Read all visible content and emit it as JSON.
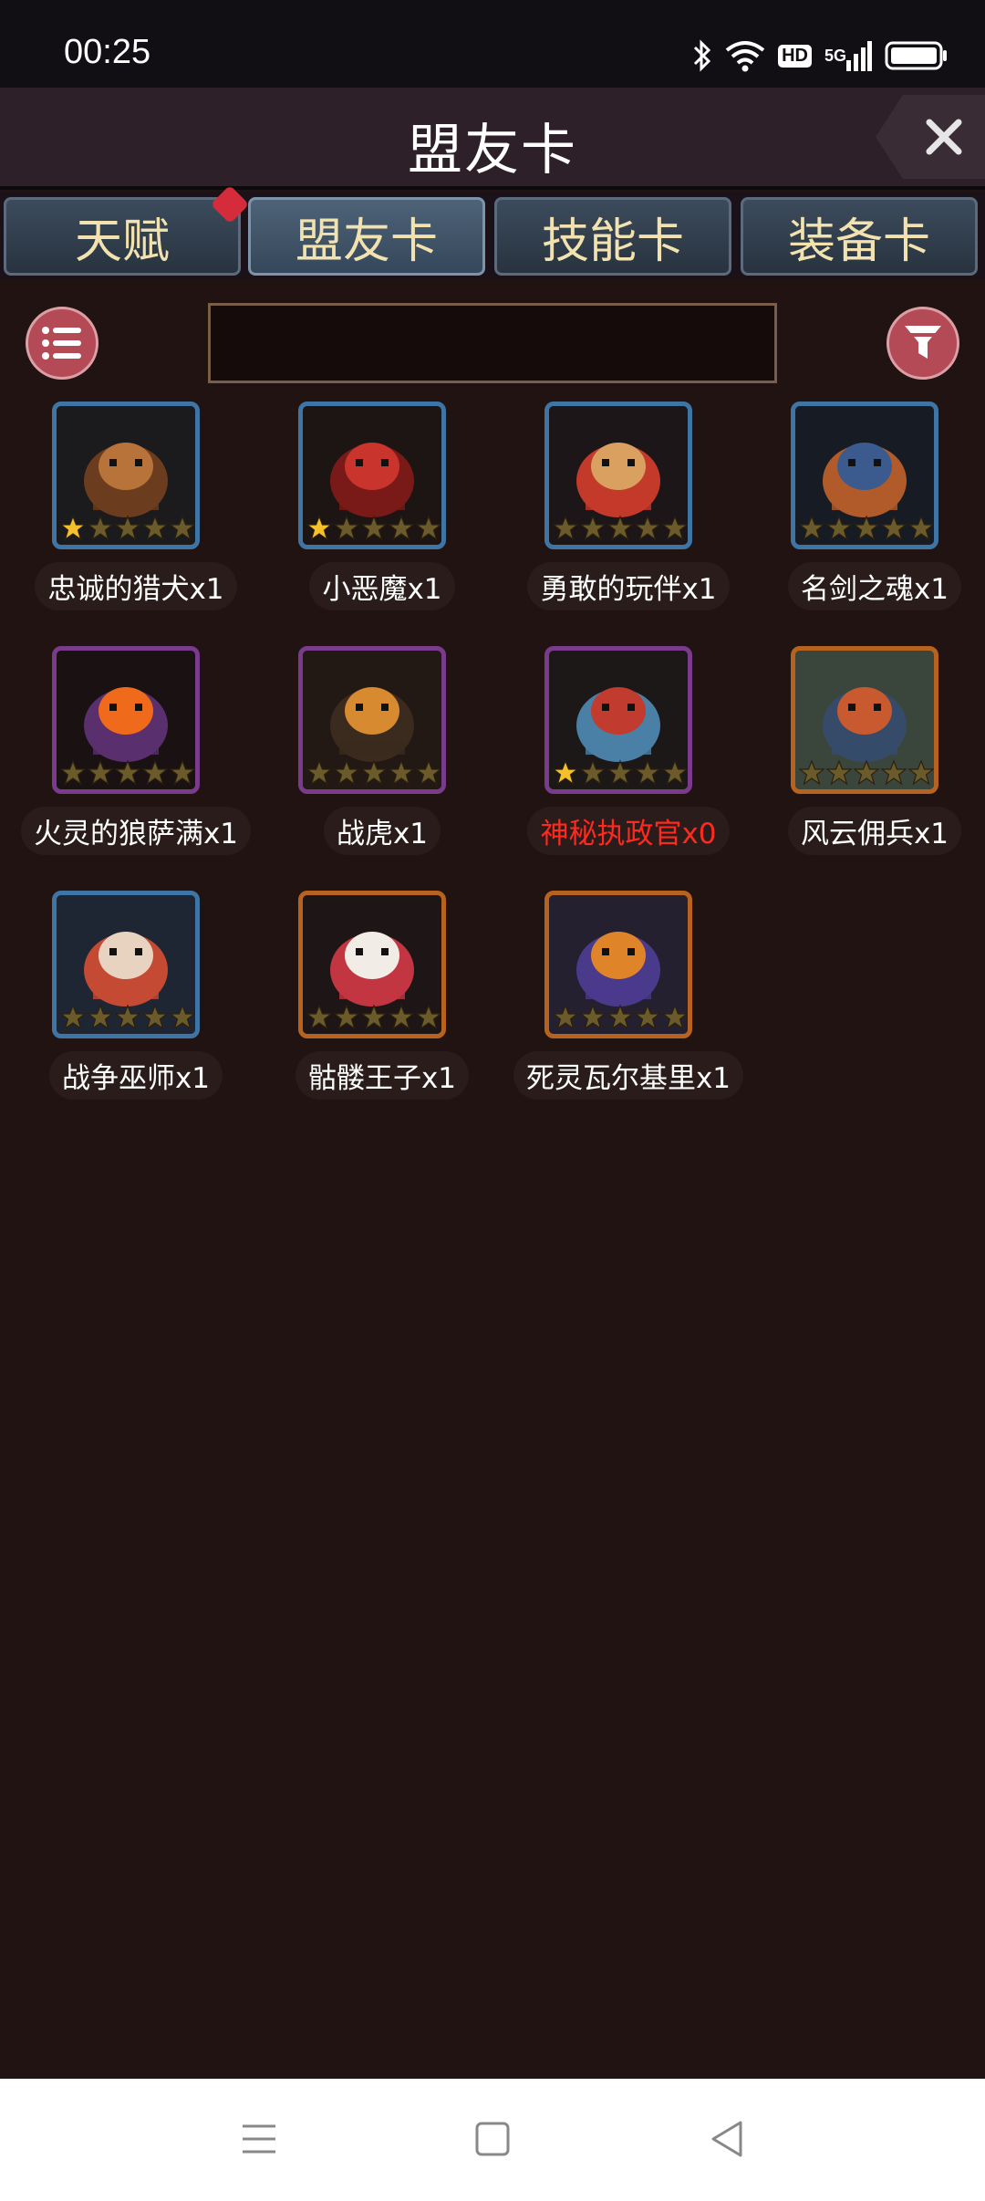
{
  "status_bar": {
    "time": "00:25",
    "network": "5G",
    "hd": "HD",
    "icons": [
      "bluetooth-icon",
      "wifi-icon",
      "hd-icon",
      "signal-5g-icon",
      "battery-icon"
    ]
  },
  "header": {
    "title": "盟友卡",
    "close_icon": "close-icon"
  },
  "tabs": [
    {
      "label": "天赋",
      "active": false,
      "badge": true
    },
    {
      "label": "盟友卡",
      "active": true,
      "badge": false
    },
    {
      "label": "技能卡",
      "active": false,
      "badge": false
    },
    {
      "label": "装备卡",
      "active": false,
      "badge": false
    }
  ],
  "toolbar": {
    "list_icon": "list-icon",
    "filter_icon": "filter-icon",
    "search_value": "",
    "search_placeholder": ""
  },
  "cards": [
    {
      "label": "忠诚的猎犬x1",
      "stars": 1,
      "frame": "blue",
      "locked": false,
      "art": "hound"
    },
    {
      "label": "小恶魔x1",
      "stars": 1,
      "frame": "blue",
      "locked": false,
      "art": "imp"
    },
    {
      "label": "勇敢的玩伴x1",
      "stars": 0,
      "frame": "blue",
      "locked": false,
      "art": "warrior"
    },
    {
      "label": "名剑之魂x1",
      "stars": 0,
      "frame": "blue",
      "locked": false,
      "art": "sword-spirit"
    },
    {
      "label": "火灵的狼萨满x1",
      "stars": 0,
      "frame": "purple",
      "locked": false,
      "art": "fire-wolf"
    },
    {
      "label": "战虎x1",
      "stars": 0,
      "frame": "purple",
      "locked": false,
      "art": "tiger"
    },
    {
      "label": "神秘执政官x0",
      "stars": 1,
      "frame": "purple",
      "locked": true,
      "art": "knight"
    },
    {
      "label": "风云佣兵x1",
      "stars": 0,
      "frame": "orange",
      "locked": false,
      "art": "mercenary"
    },
    {
      "label": "战争巫师x1",
      "stars": 0,
      "frame": "blue",
      "locked": false,
      "art": "wizard"
    },
    {
      "label": "骷髅王子x1",
      "stars": 0,
      "frame": "orange",
      "locked": false,
      "art": "skeleton"
    },
    {
      "label": "死灵瓦尔基里x1",
      "stars": 0,
      "frame": "orange",
      "locked": false,
      "art": "valkyrie"
    }
  ],
  "colors": {
    "background": "#211311",
    "star_active": "#f5c02a",
    "star_inactive": "#6b5a2a",
    "locked_text": "#ff2a1f",
    "frame_blue": "#3e75a5",
    "frame_purple": "#7a3b8c",
    "frame_orange": "#b8621f"
  },
  "nav_bar": {
    "icons": [
      "menu-icon",
      "home-icon",
      "back-icon"
    ]
  }
}
